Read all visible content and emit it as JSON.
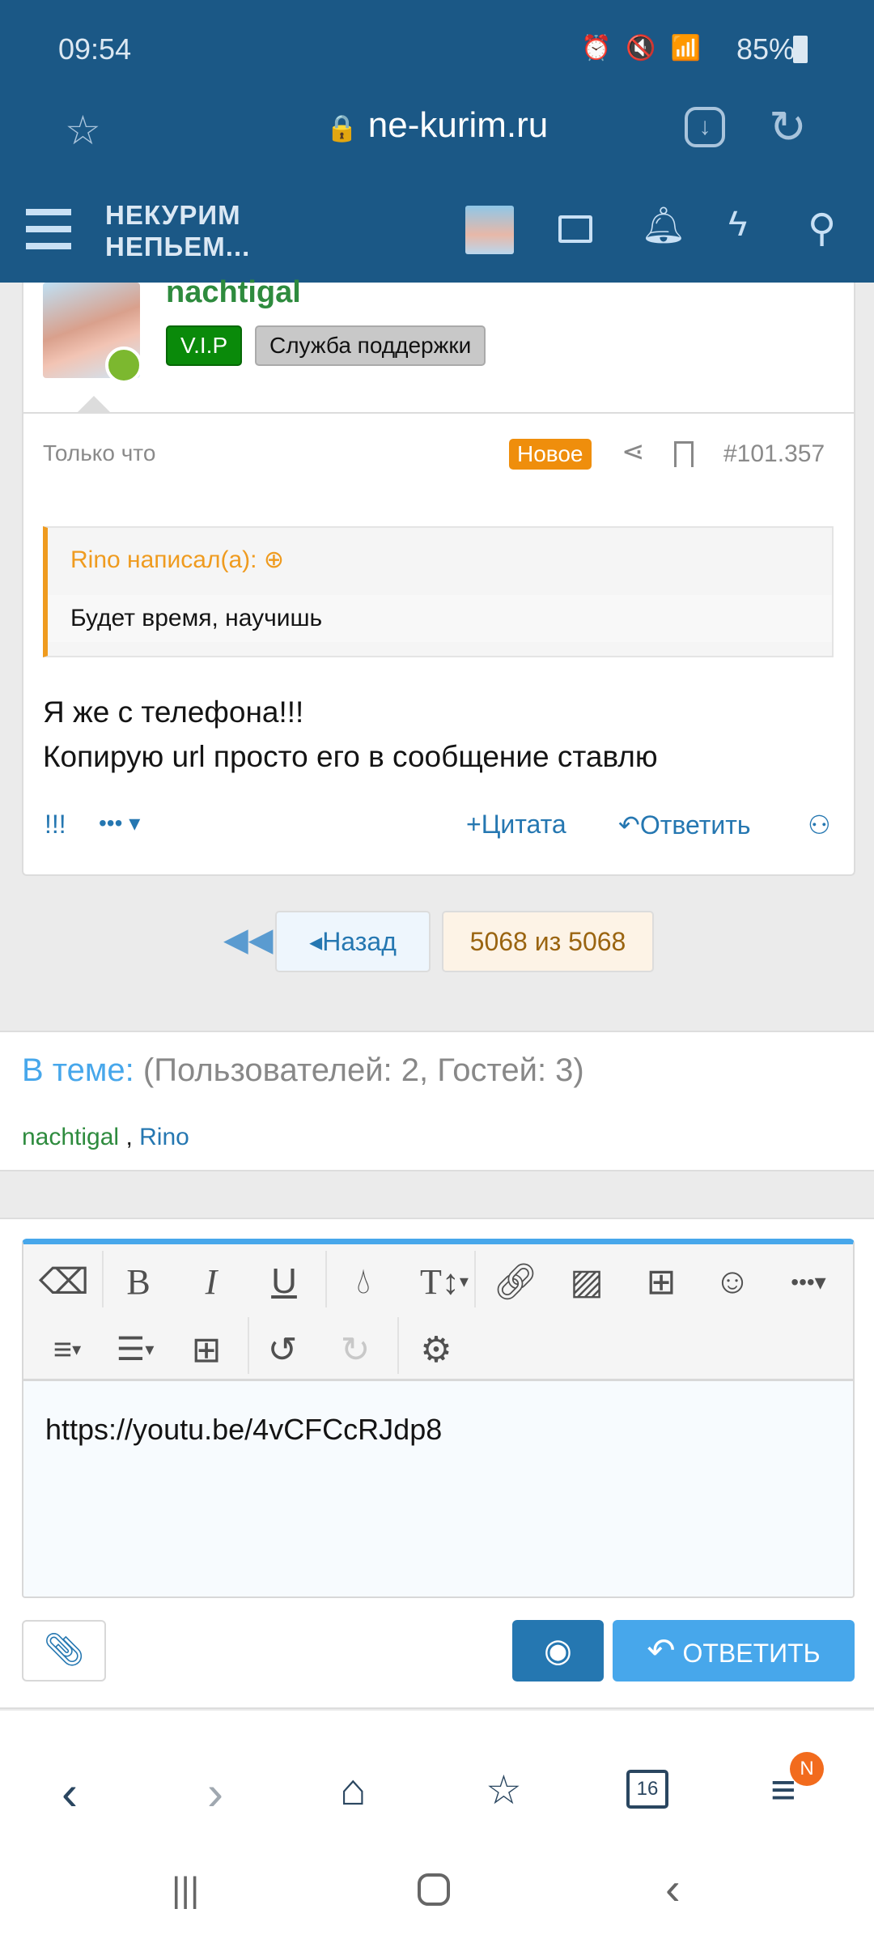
{
  "status_bar": {
    "time": "09:54",
    "battery": "85%"
  },
  "browser": {
    "url": "ne-kurim.ru",
    "tabs_count": "16",
    "menu_badge": "N"
  },
  "site": {
    "logo_line1": "НЕКУРИМ",
    "logo_line2": "НЕПЬЕМ..."
  },
  "post": {
    "username": "nachtigal",
    "username_color": "#2e8b3e",
    "badges": [
      {
        "label": "V.I.P",
        "color": "#0a8a0a"
      },
      {
        "label": "Служба поддержки",
        "color": "#c8c8c8"
      }
    ],
    "time": "Только что",
    "new_label": "Новое",
    "post_number": "#101.357",
    "quote": {
      "author": "Rino написал(а):",
      "text": "Будет время, научишь"
    },
    "lines": [
      "Я же с телефона!!!",
      "Копирую url просто его в сообщение ставлю"
    ],
    "actions": {
      "react": "!!!",
      "quote": "Цитата",
      "reply": "Ответить"
    }
  },
  "pagination": {
    "prev": "Назад",
    "current": "5068 из 5068"
  },
  "in_thread": {
    "label": "В теме:",
    "counts": "(Пользователей: 2, Гостей: 3)",
    "users": [
      "nachtigal",
      "Rino"
    ],
    "separator": ","
  },
  "editor": {
    "content": "https://youtu.be/4vCFCcRJdp8",
    "submit": "ОТВЕТИТЬ",
    "accent": "#47a7eb"
  }
}
